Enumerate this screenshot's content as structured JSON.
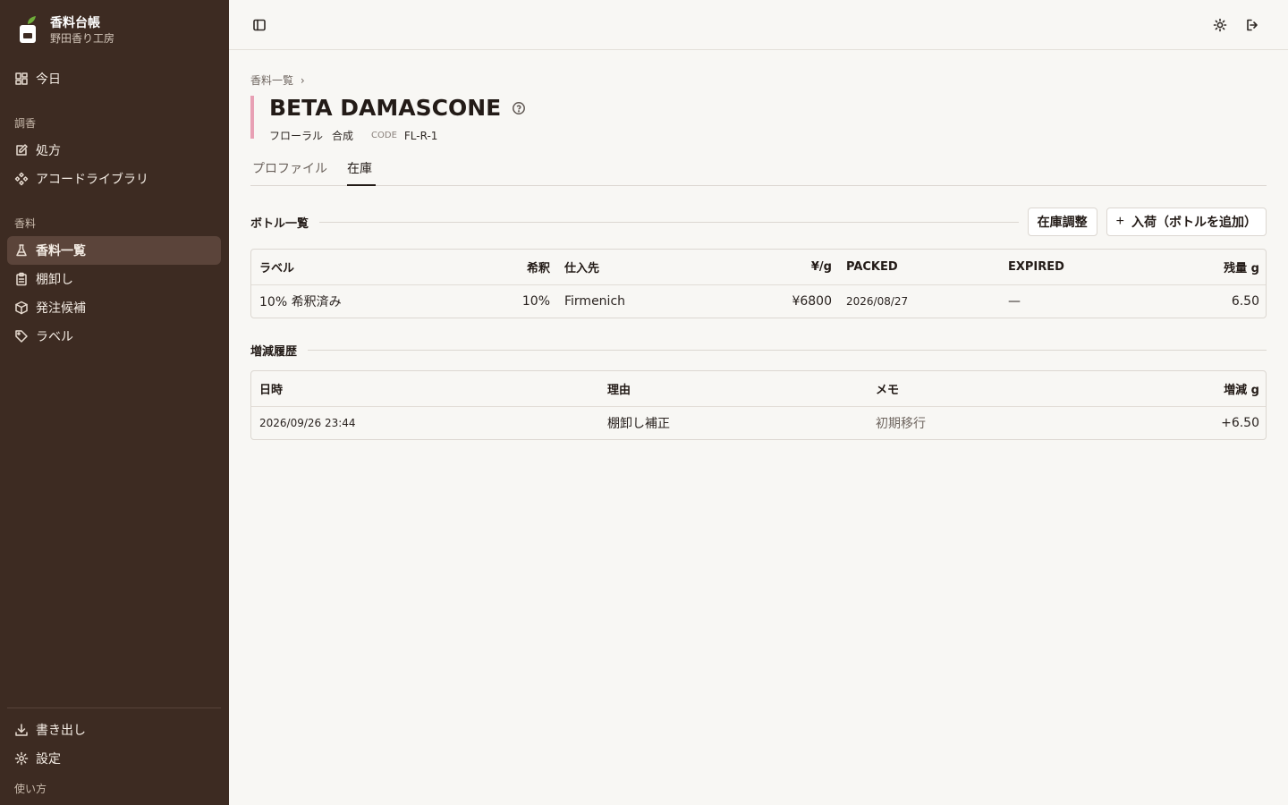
{
  "app": {
    "title": "香料台帳",
    "subtitle": "野田香り工房"
  },
  "sidebar": {
    "today": "今日",
    "sections": {
      "blending": "調香",
      "materials": "香料"
    },
    "blending_items": [
      {
        "label": "処方",
        "icon": "edit-icon"
      },
      {
        "label": "アコードライブラリ",
        "icon": "diamond-cluster-icon"
      }
    ],
    "material_items": [
      {
        "label": "香料一覧",
        "icon": "flask-icon",
        "active": true
      },
      {
        "label": "棚卸し",
        "icon": "clipboard-icon"
      },
      {
        "label": "発注候補",
        "icon": "box-icon"
      },
      {
        "label": "ラベル",
        "icon": "tag-icon"
      }
    ],
    "footer_items": [
      {
        "label": "書き出し",
        "icon": "download-icon"
      },
      {
        "label": "設定",
        "icon": "gear-icon"
      }
    ],
    "help": "使い方"
  },
  "breadcrumb": {
    "parent": "香料一覧",
    "separator": "›"
  },
  "material": {
    "name": "BETA DAMASCONE",
    "family": "フローラル",
    "kind": "合成",
    "code_label": "CODE",
    "code": "FL-R-1",
    "accent_color": "#e8a0b4"
  },
  "tabs": {
    "profile": "プロファイル",
    "inventory": "在庫"
  },
  "bottles": {
    "heading": "ボトル一覧",
    "adjust_button": "在庫調整",
    "add_button": "入荷（ボトルを追加）",
    "columns": [
      "ラベル",
      "希釈",
      "仕入先",
      "¥/g",
      "PACKED",
      "EXPIRED",
      "残量 g"
    ],
    "rows": [
      [
        "10% 希釈済み",
        "10%",
        "Firmenich",
        "¥6800",
        "2026/08/27",
        "—",
        "6.50"
      ]
    ]
  },
  "history": {
    "heading": "増減履歴",
    "columns": [
      "日時",
      "理由",
      "メモ",
      "増減 g"
    ],
    "rows": [
      [
        "2026/09/26 23:44",
        "棚卸し補正",
        "初期移行",
        "+6.50"
      ]
    ]
  }
}
